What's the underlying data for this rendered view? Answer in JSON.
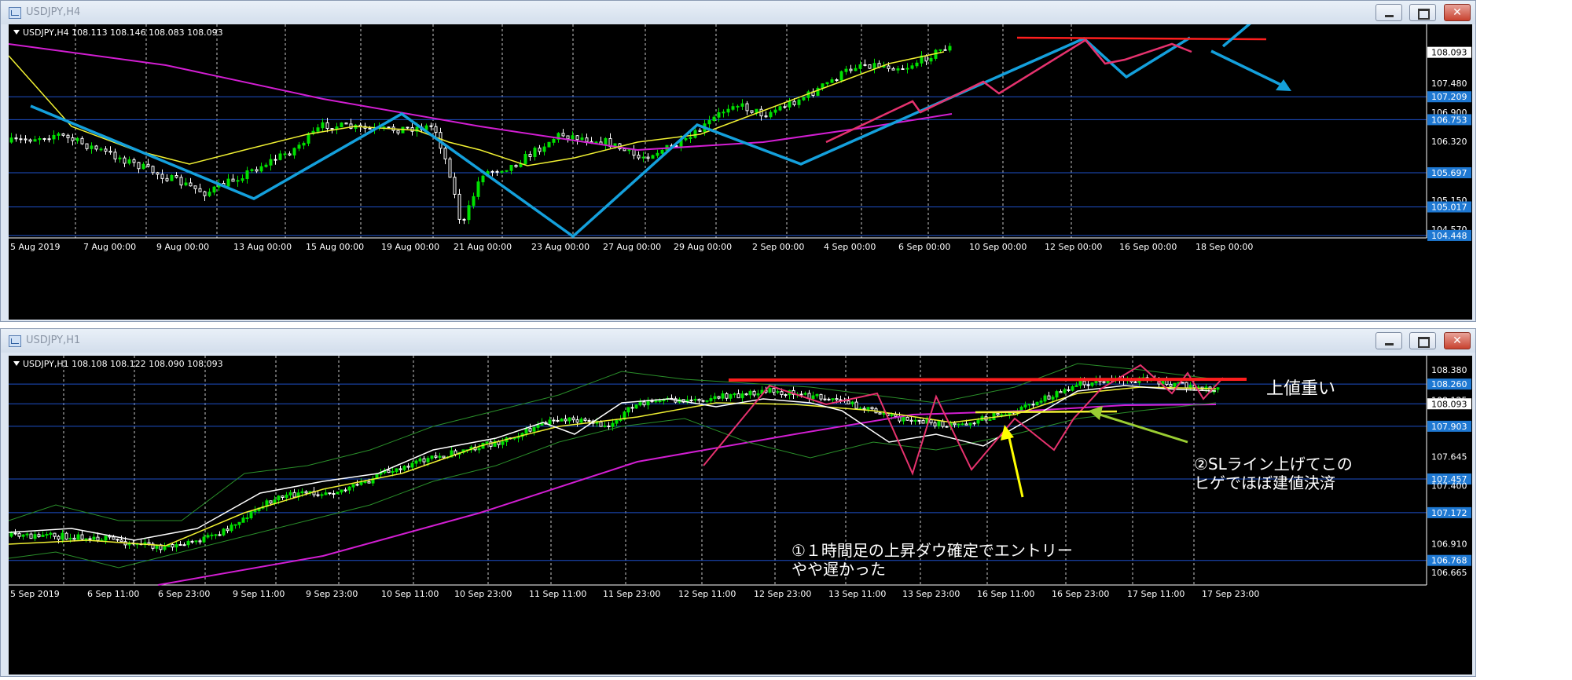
{
  "windows": [
    {
      "title": "USDJPY,H4",
      "info": "USDJPY,H4  108.113 108.146 108.083 108.093",
      "xlabels": [
        "5 Aug 2019",
        "7 Aug 00:00",
        "9 Aug 00:00",
        "13 Aug 00:00",
        "15 Aug 00:00",
        "19 Aug 00:00",
        "21 Aug 00:00",
        "23 Aug 00:00",
        "27 Aug 00:00",
        "29 Aug 00:00",
        "2 Sep 00:00",
        "4 Sep 00:00",
        "6 Sep 00:00",
        "10 Sep 00:00",
        "12 Sep 00:00",
        "16 Sep 00:00",
        "18 Sep 00:00"
      ],
      "ylabels": [
        "108.093",
        "107.480",
        "107.209",
        "106.900",
        "106.753",
        "106.320",
        "105.697",
        "105.150",
        "105.017",
        "104.570",
        "104.448"
      ],
      "ylevels": [
        108.093,
        107.48,
        107.209,
        106.9,
        106.753,
        106.32,
        105.697,
        105.15,
        105.017,
        104.57,
        104.448
      ],
      "yhl": [
        false,
        false,
        true,
        false,
        true,
        false,
        true,
        false,
        true,
        false,
        true
      ],
      "ymin": 104.4,
      "ymax": 108.65,
      "hlines": [
        107.209,
        106.753,
        105.697,
        105.017,
        104.448
      ],
      "annotations": []
    },
    {
      "title": "USDJPY,H1",
      "info": "USDJPY,H1  108.108 108.122 108.090 108.093",
      "xlabels": [
        "5 Sep 2019",
        "6 Sep 11:00",
        "6 Sep 23:00",
        "9 Sep 11:00",
        "9 Sep 23:00",
        "10 Sep 11:00",
        "10 Sep 23:00",
        "11 Sep 11:00",
        "11 Sep 23:00",
        "12 Sep 11:00",
        "12 Sep 23:00",
        "13 Sep 11:00",
        "13 Sep 23:00",
        "16 Sep 11:00",
        "16 Sep 23:00",
        "17 Sep 11:00",
        "17 Sep 23:00"
      ],
      "ylabels": [
        "108.380",
        "108.260",
        "108.125",
        "108.093",
        "107.903",
        "107.645",
        "107.457",
        "107.400",
        "107.172",
        "106.910",
        "106.768",
        "106.665"
      ],
      "ylevels": [
        108.38,
        108.26,
        108.125,
        108.093,
        107.903,
        107.645,
        107.457,
        107.4,
        107.172,
        106.91,
        106.768,
        106.665
      ],
      "yhl": [
        false,
        true,
        false,
        false,
        true,
        false,
        true,
        false,
        true,
        false,
        true,
        false
      ],
      "ymin": 106.56,
      "ymax": 108.5,
      "hlines": [
        108.26,
        108.093,
        107.903,
        107.457,
        107.172,
        106.768
      ],
      "annotations": [
        "上値重い",
        "②SLライン上げてこの",
        "ヒゲでほぼ建値決済",
        "①１時間足の上昇ダウ確定でエントリー",
        "やや遅かった"
      ]
    }
  ],
  "colors": {
    "up": "#00e000",
    "down": "#ffffff",
    "hline": "#1e50c8",
    "priceTag": "#1e78d2",
    "ma200": "#d21ed2",
    "maYellow": "#f0f032",
    "zigzagBlue": "#14a0dc",
    "zigzagPink": "#e6326e",
    "resistance": "#ff1e1e",
    "greenArrow": "#9acd32",
    "yellowArrow": "#ffff00"
  }
}
